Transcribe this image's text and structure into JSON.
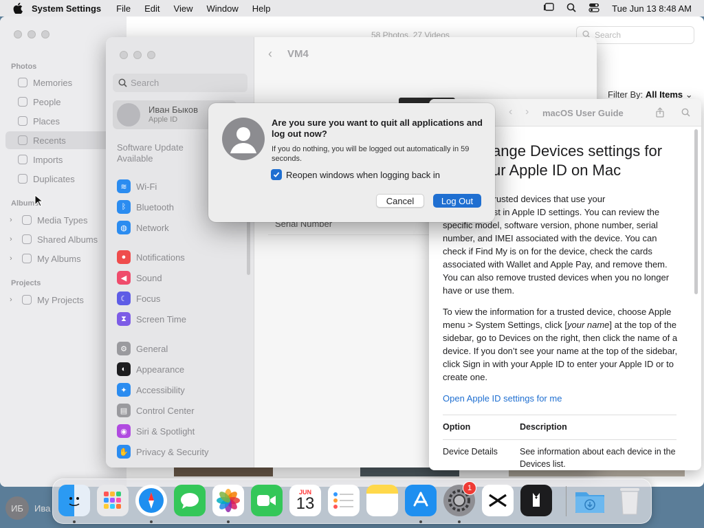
{
  "menubar": {
    "app_name": "System Settings",
    "menus": [
      "File",
      "Edit",
      "View",
      "Window",
      "Help"
    ],
    "clock": "Tue Jun 13  8:48 AM"
  },
  "photos": {
    "stats": "58 Photos, 27 Videos",
    "search_placeholder": "Search",
    "filter_label": "Filter By:",
    "filter_value": "All Items",
    "sections": {
      "photos": "Photos",
      "albums": "Albums",
      "projects": "Projects"
    },
    "items": [
      "Memories",
      "People",
      "Places",
      "Recents",
      "Imports",
      "Duplicates"
    ],
    "album_items": [
      "Media Types",
      "Shared Albums",
      "My Albums"
    ],
    "project_items": [
      "My Projects"
    ]
  },
  "settings": {
    "search_placeholder": "Search",
    "account_name": "Иван Быков",
    "account_sub": "Apple ID",
    "software_update": "Software Update Available",
    "items": [
      {
        "label": "Wi-Fi",
        "color": "#2b8cf0"
      },
      {
        "label": "Bluetooth",
        "color": "#2b8cf0"
      },
      {
        "label": "Network",
        "color": "#2b8cf0"
      },
      {
        "label": "Notifications",
        "color": "#ef4c4c"
      },
      {
        "label": "Sound",
        "color": "#ef4c6c"
      },
      {
        "label": "Focus",
        "color": "#5e5ce6"
      },
      {
        "label": "Screen Time",
        "color": "#7d5ce6"
      },
      {
        "label": "General",
        "color": "#9a9a9e"
      },
      {
        "label": "Appearance",
        "color": "#1d1d1f"
      },
      {
        "label": "Accessibility",
        "color": "#2b8cf0"
      },
      {
        "label": "Control Center",
        "color": "#9a9a9e"
      },
      {
        "label": "Siri & Spotlight",
        "color": "#b04ae0"
      },
      {
        "label": "Privacy & Security",
        "color": "#2b8cf0"
      }
    ],
    "detail_title": "VM4",
    "serial_label": "Serial Number"
  },
  "help": {
    "title": "macOS User Guide",
    "heading": "ange Devices settings for\nur Apple ID on Mac",
    "p1": ", review the trusted devices that use your\n     he Devices list in Apple ID settings. You can review the specific model, software version, phone number, serial number, and IMEI associated with the device. You can check if Find My is on for the device, check the cards associated with Wallet and Apple Pay, and remove them. You can also remove trusted devices when you no longer have or use them.",
    "p2a": "To view the information for a trusted device, choose Apple menu  > System Settings, click [",
    "p2_em": "your name",
    "p2b": "] at the top of the sidebar, go to Devices on the right, then click the name of a device. If you don’t see your name at the top of the sidebar, click Sign in with your Apple ID to enter your Apple ID or to create one.",
    "link": "Open Apple ID settings for me",
    "table": {
      "headers": [
        "Option",
        "Description"
      ],
      "rows": [
        [
          "Device Details",
          "See information about each device in the Devices list."
        ]
      ]
    }
  },
  "dialog": {
    "title": "Are you sure you want to quit all applications and log out now?",
    "message": "If you do nothing, you will be logged out automatically in 59 seconds.",
    "checkbox_label": "Reopen windows when logging back in",
    "checkbox_checked": true,
    "cancel": "Cancel",
    "confirm": "Log Out",
    "accent": "#1f6fd1"
  },
  "dock": {
    "calendar_month": "JUN",
    "calendar_day": "13",
    "settings_badge": "1",
    "apps": [
      "finder-icon",
      "launchpad-icon",
      "safari-icon",
      "messages-icon",
      "photos-icon",
      "facetime-icon",
      "calendar-icon",
      "reminders-icon",
      "notes-icon",
      "app-store-icon",
      "system-settings-icon",
      "capcut-icon",
      "bartender-icon",
      "downloads-folder-icon",
      "trash-icon"
    ]
  },
  "user": {
    "initials": "ИБ",
    "name_partial": "Ива"
  }
}
